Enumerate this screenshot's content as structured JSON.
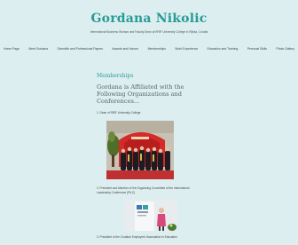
{
  "site": {
    "title": "Gordana Nikolic",
    "tagline": "International Business Woman and Faculty Dean at RRiF University College in Rijeka, Croatia"
  },
  "nav": {
    "items": [
      "Home Page",
      "Meet Gordana",
      "Scientific and Professional Papers",
      "Awards and Honors",
      "Memberships",
      "Work Experience",
      "Education and Training",
      "Personal Skills",
      "Photo Gallery"
    ]
  },
  "main": {
    "section_title": "Memberships",
    "heading": "Gordana is Affiliated with the Following Organizations and Conferences...",
    "items": [
      "1. Dean of RRiF University College",
      "2. President and Member of the Organizing Committee of the International Leadership Conference (PILC)",
      "3. President of the Croatian Employers' Association in Education"
    ]
  },
  "colors": {
    "background": "#dceef0",
    "accent": "#2a9a94"
  }
}
